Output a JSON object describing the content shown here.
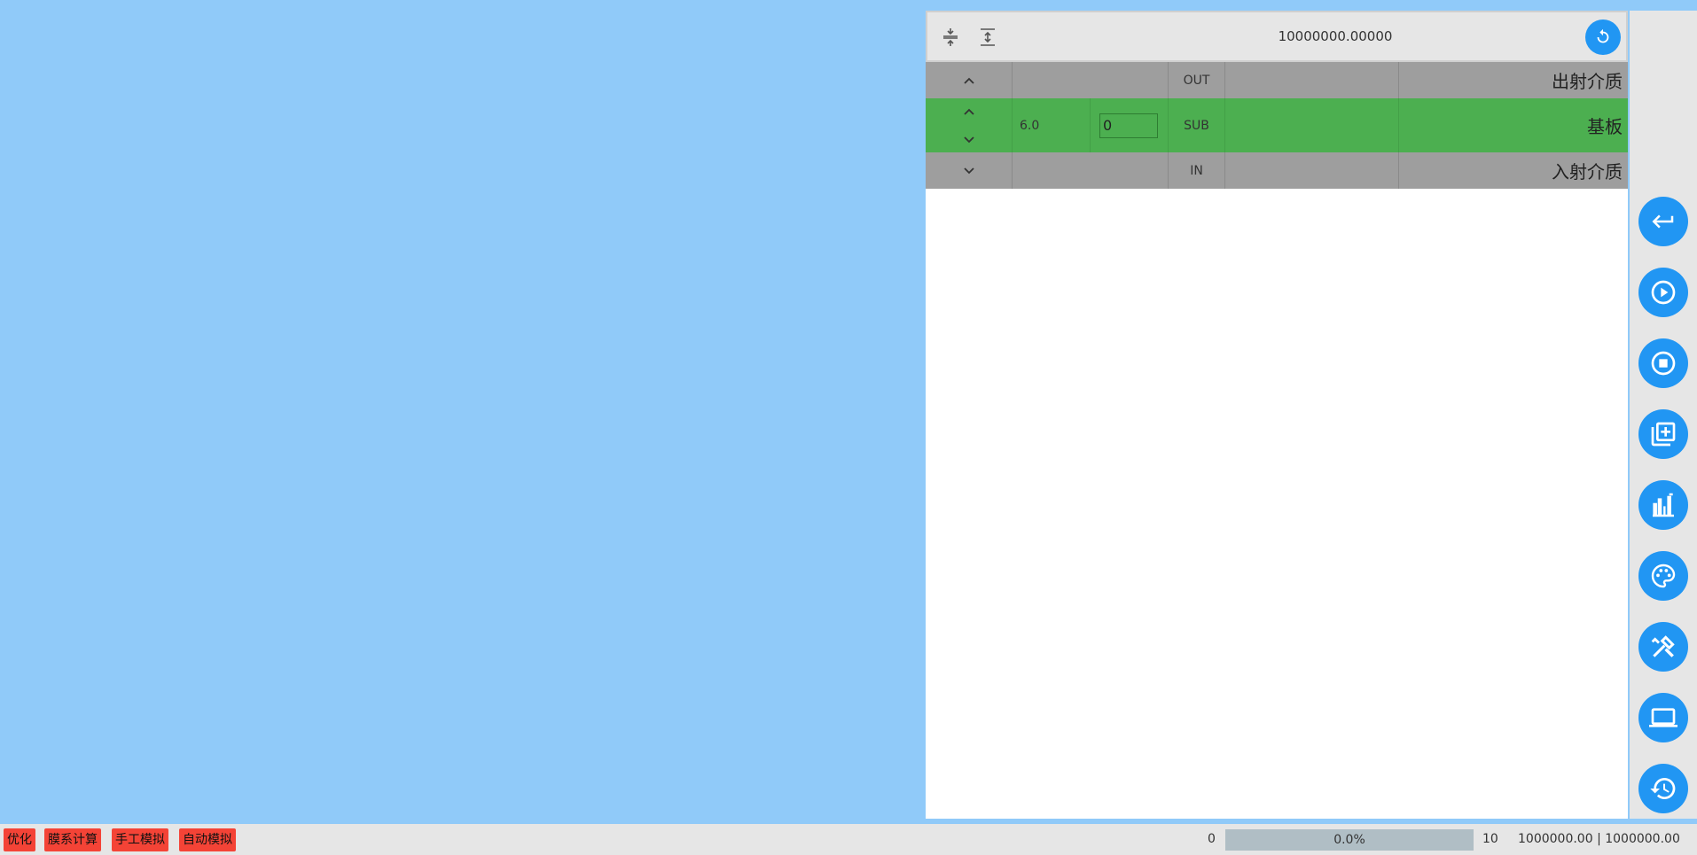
{
  "toolbar": {
    "value": "10000000.00000",
    "collapse_icon": "compress-vertical-icon",
    "expand_icon": "expand-vertical-icon",
    "refresh_icon": "refresh-icon"
  },
  "layers": [
    {
      "kind": "out",
      "n": "",
      "d": "",
      "tag": "OUT",
      "name": "出射介质"
    },
    {
      "kind": "sub",
      "n": "6.0",
      "d": "0",
      "tag": "SUB",
      "name": "基板"
    },
    {
      "kind": "in",
      "n": "",
      "d": "",
      "tag": "IN",
      "name": "入射介质"
    }
  ],
  "side_buttons": [
    "return-icon",
    "play-icon",
    "stop-icon",
    "add-layer-icon",
    "chart-icon",
    "palette-icon",
    "tools-icon",
    "laptop-icon",
    "history-icon"
  ],
  "status": {
    "tags": [
      "优化",
      "膜系计算",
      "手工模拟",
      "自动模拟"
    ],
    "progress_min": "0",
    "progress_max": "10",
    "progress_percent": 0,
    "progress_label": "0.0%",
    "values": "1000000.00 | 1000000.00"
  },
  "colors": {
    "accent": "#2196f3",
    "canvas": "#90caf9",
    "substrate_row": "#4caf50",
    "medium_row": "#9e9e9e",
    "tag_button": "#f44336"
  }
}
